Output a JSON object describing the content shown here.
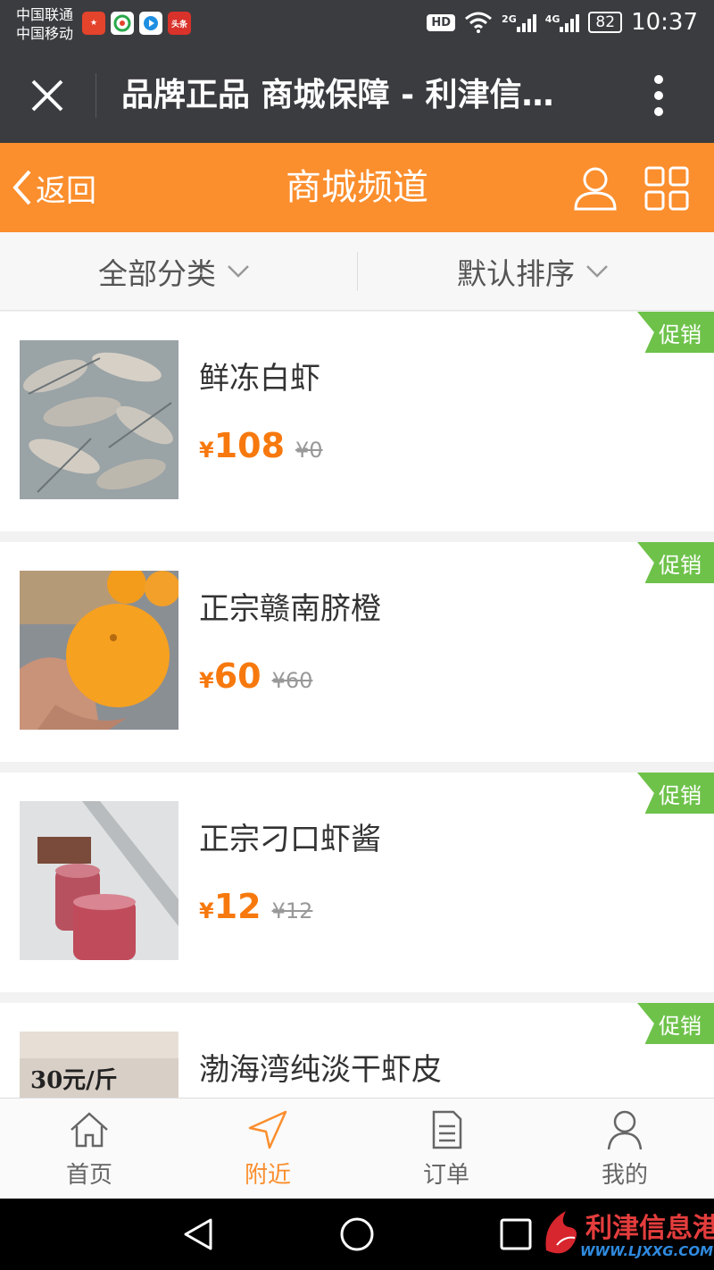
{
  "status_bar": {
    "carrier_1": "中国联通",
    "carrier_2": "中国移动",
    "app_badges": [
      "sina",
      "browser",
      "video",
      "头条"
    ],
    "hd": "HD",
    "net_1": "2G",
    "net_2": "4G",
    "battery": "82",
    "time": "10:37"
  },
  "titlebar": {
    "title": "品牌正品 商城保障 - 利津信…",
    "close_icon": "close-icon",
    "more_icon": "more-vertical-icon"
  },
  "shop_header": {
    "back_label": "返回",
    "title": "商城频道",
    "user_icon": "user-icon",
    "grid_icon": "grid-icon",
    "accent": "#fb8e2d"
  },
  "filters": {
    "category": "全部分类",
    "sort": "默认排序"
  },
  "products": [
    {
      "name": "鲜冻白虾",
      "yen": "¥",
      "price": "108",
      "original": "¥0",
      "badge": "促销"
    },
    {
      "name": "正宗赣南脐橙",
      "yen": "¥",
      "price": "60",
      "original": "¥60",
      "badge": "促销"
    },
    {
      "name": "正宗刁口虾酱",
      "yen": "¥",
      "price": "12",
      "original": "¥12",
      "badge": "促销"
    },
    {
      "name": "渤海湾纯淡干虾皮",
      "yen": "¥",
      "price": "",
      "original": "",
      "badge": "促销",
      "thumb_text": "30元/斤"
    }
  ],
  "tabs": [
    {
      "label": "首页",
      "icon": "home-icon"
    },
    {
      "label": "附近",
      "icon": "location-arrow-icon",
      "active": true
    },
    {
      "label": "订单",
      "icon": "document-icon"
    },
    {
      "label": "我的",
      "icon": "person-icon"
    }
  ],
  "watermark": {
    "name": "利津信息港",
    "url": "WWW.LJXXG.COM"
  }
}
